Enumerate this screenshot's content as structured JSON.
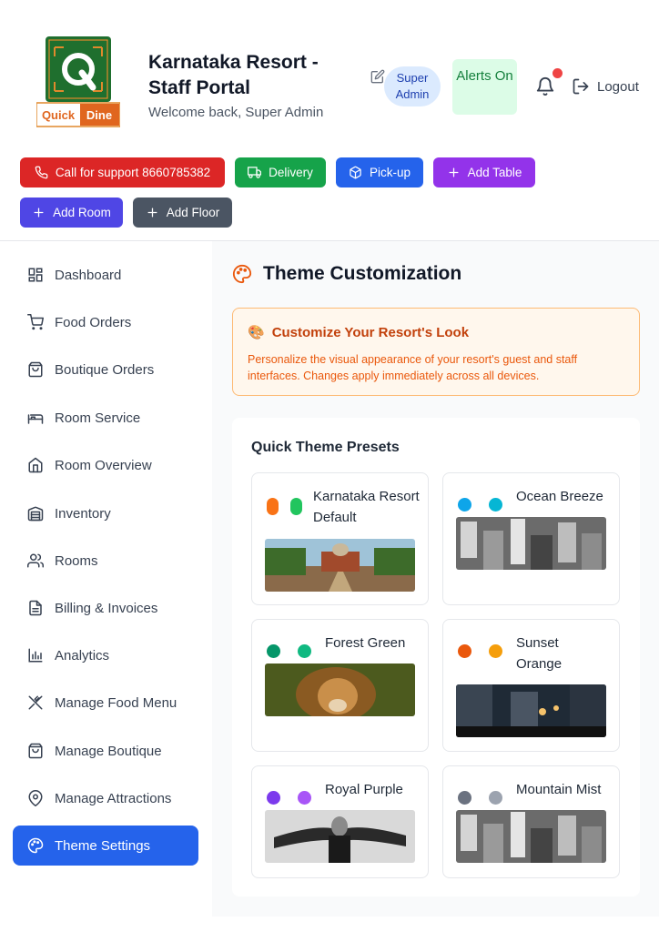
{
  "header": {
    "brand": {
      "quick": "Quick",
      "dine": "Dine"
    },
    "title": "Karnataka Resort - Staff Portal",
    "welcome": "Welcome back, Super Admin",
    "role": "Super Admin",
    "alerts": "Alerts On",
    "logout": "Logout"
  },
  "actions": [
    {
      "label": "Call for support 8660785382",
      "icon": "phone-icon",
      "color": "#dc2626"
    },
    {
      "label": "Delivery",
      "icon": "truck-icon",
      "color": "#16a34a"
    },
    {
      "label": "Pick-up",
      "icon": "package-icon",
      "color": "#2563eb"
    },
    {
      "label": "Add Table",
      "icon": "plus-icon",
      "color": "#9333ea"
    },
    {
      "label": "Add Room",
      "icon": "plus-icon",
      "color": "#4f46e5"
    },
    {
      "label": "Add Floor",
      "icon": "plus-icon",
      "color": "#4b5563"
    }
  ],
  "sidebar": {
    "items": [
      {
        "label": "Dashboard",
        "icon": "grid-icon"
      },
      {
        "label": "Food Orders",
        "icon": "cart-icon"
      },
      {
        "label": "Boutique Orders",
        "icon": "bag-icon"
      },
      {
        "label": "Room Service",
        "icon": "bed-icon"
      },
      {
        "label": "Room Overview",
        "icon": "home-icon"
      },
      {
        "label": "Inventory",
        "icon": "warehouse-icon"
      },
      {
        "label": "Rooms",
        "icon": "users-icon"
      },
      {
        "label": "Billing & Invoices",
        "icon": "file-icon"
      },
      {
        "label": "Analytics",
        "icon": "bar-chart-icon"
      },
      {
        "label": "Manage Food Menu",
        "icon": "utensils-icon"
      },
      {
        "label": "Manage Boutique",
        "icon": "bag-icon"
      },
      {
        "label": "Manage Attractions",
        "icon": "map-pin-icon"
      },
      {
        "label": "Theme Settings",
        "icon": "palette-icon",
        "active": true
      }
    ]
  },
  "main": {
    "title": "Theme Customization",
    "info": {
      "emoji": "🎨",
      "title": "Customize Your Resort's Look",
      "text": "Personalize the visual appearance of your resort's guest and staff interfaces. Changes apply immediately across all devices."
    },
    "presets_title": "Quick Theme Presets",
    "presets": [
      {
        "name": "Karnataka Resort Default",
        "colors": [
          "#f97316",
          "#22c55e"
        ]
      },
      {
        "name": "Ocean Breeze",
        "colors": [
          "#0ea5e9",
          "#06b6d4"
        ]
      },
      {
        "name": "Forest Green",
        "colors": [
          "#059669",
          "#10b981"
        ]
      },
      {
        "name": "Sunset Orange",
        "colors": [
          "#ea580c",
          "#f59e0b"
        ]
      },
      {
        "name": "Royal Purple",
        "colors": [
          "#7c3aed",
          "#a855f7"
        ]
      },
      {
        "name": "Mountain Mist",
        "colors": [
          "#6b7280",
          "#9ca3af"
        ]
      }
    ]
  }
}
